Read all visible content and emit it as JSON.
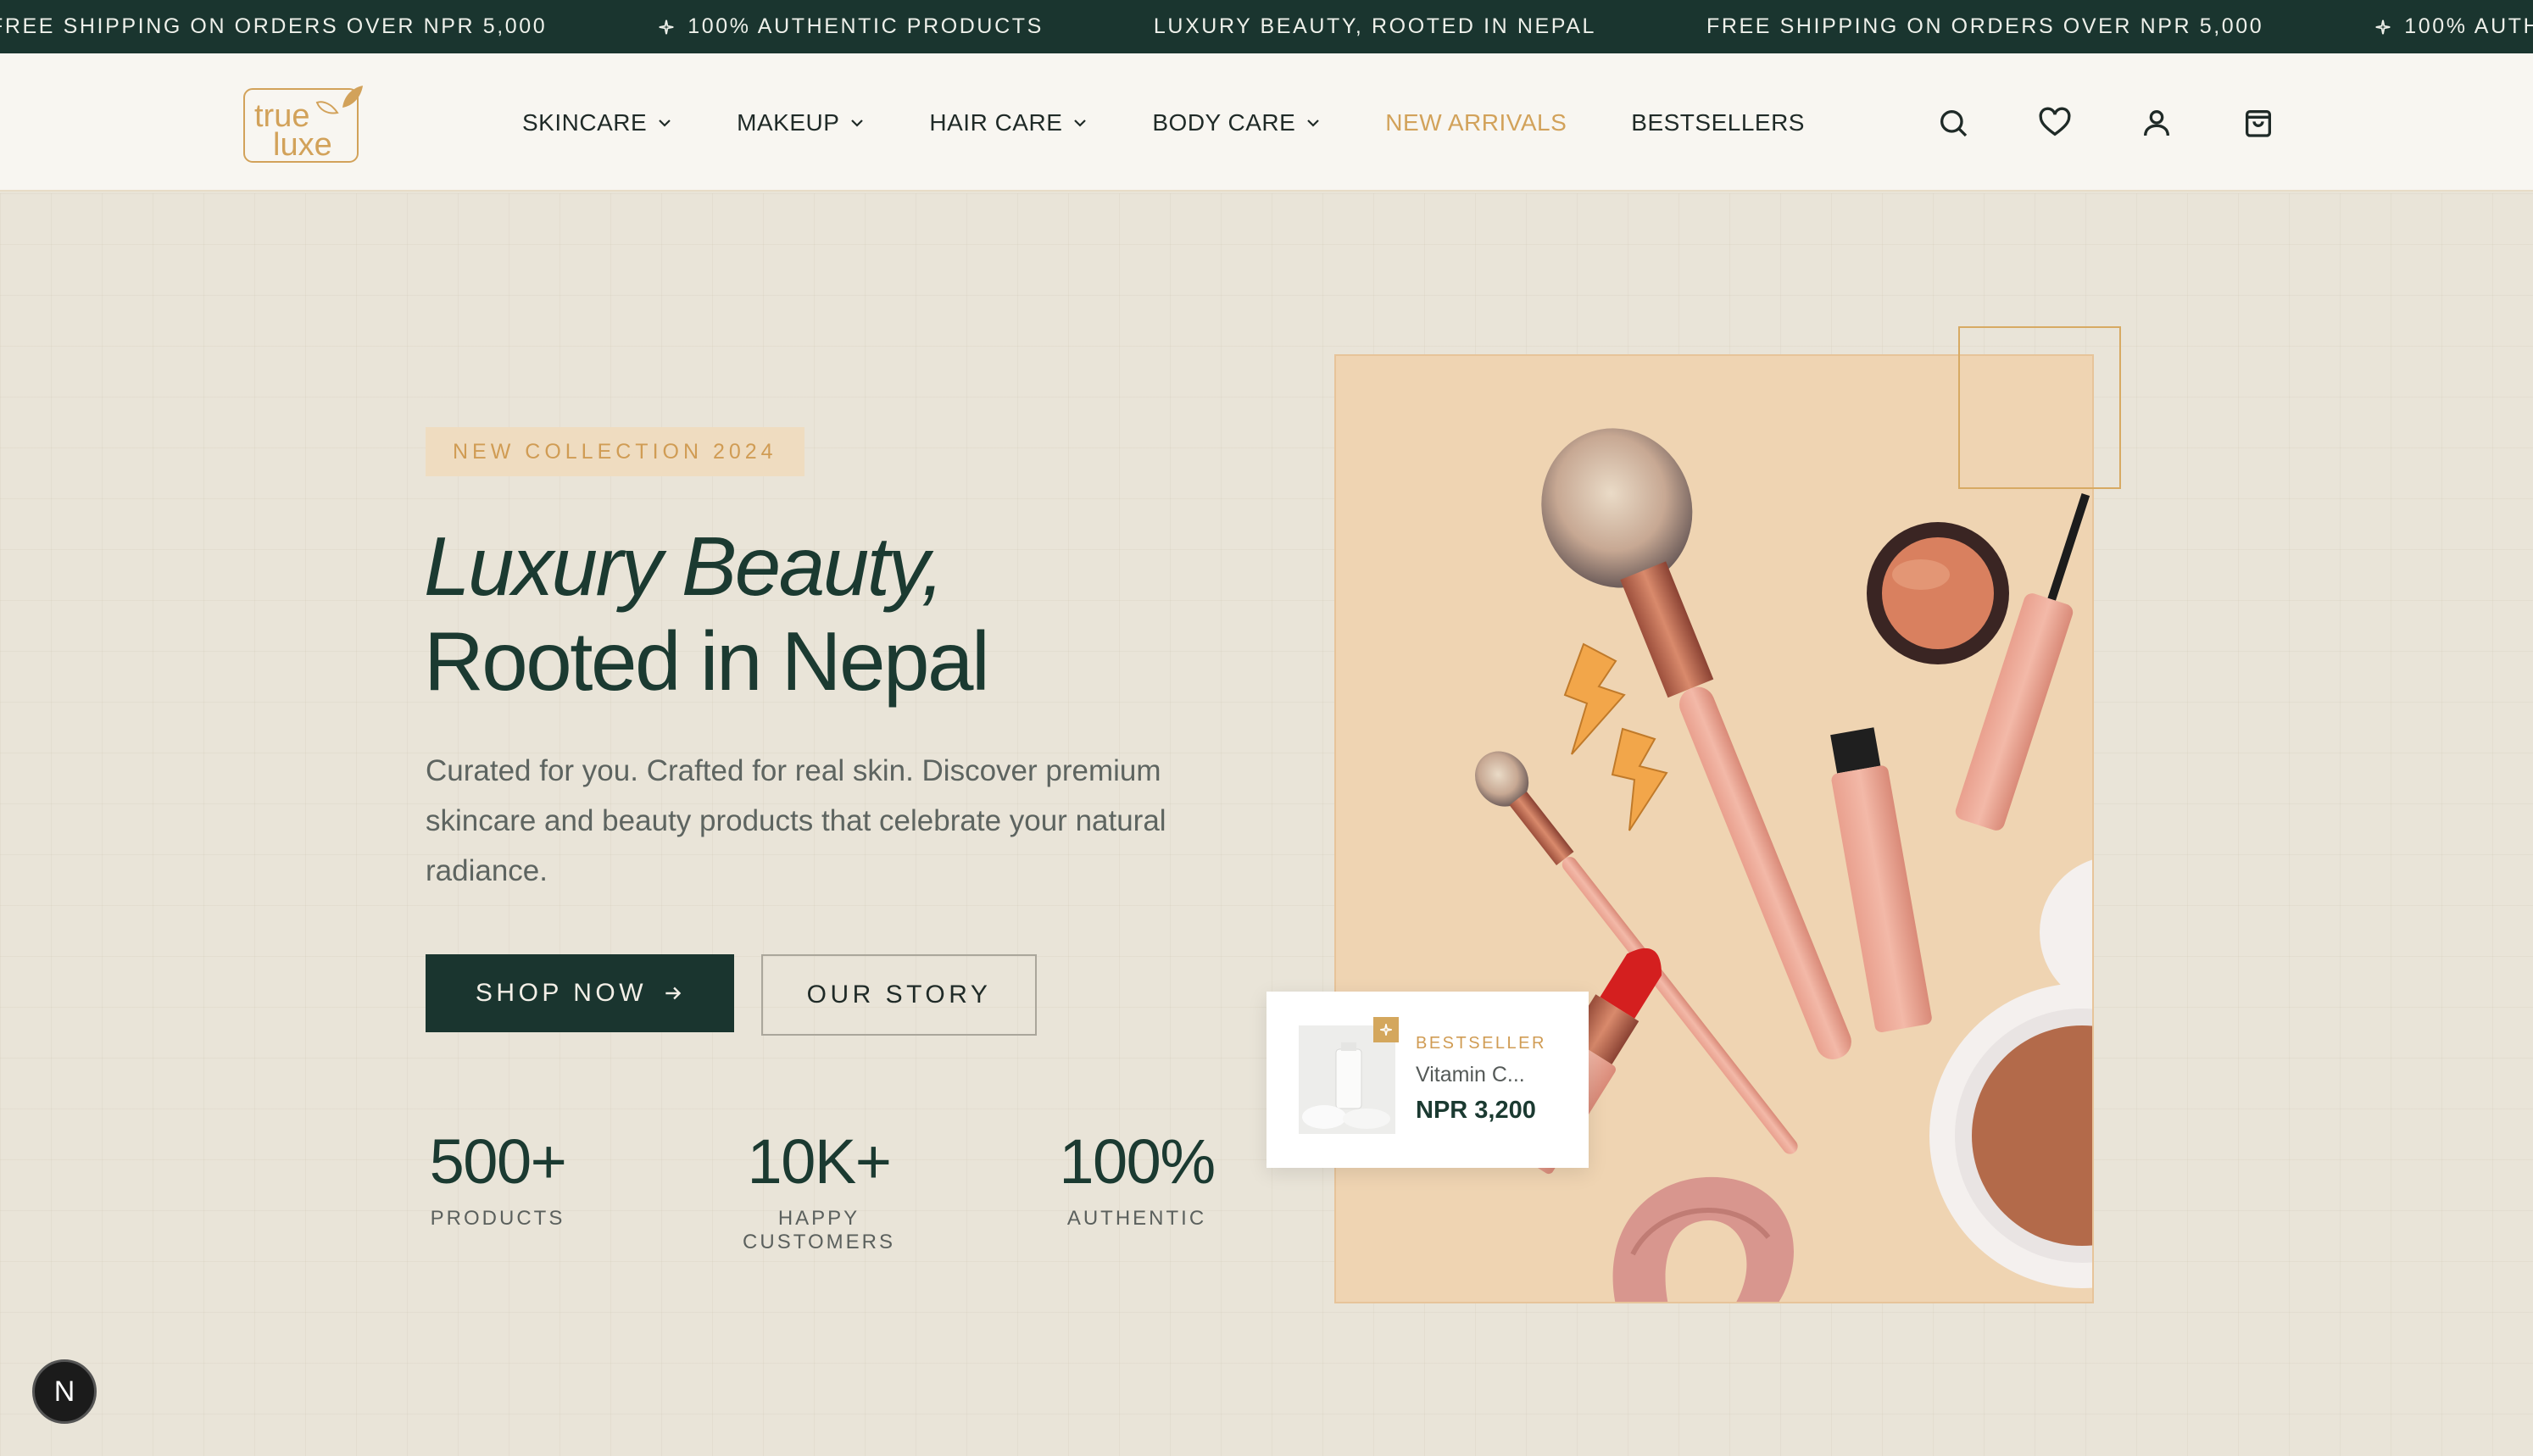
{
  "announcement": {
    "messages": [
      "FREE SHIPPING ON ORDERS OVER NPR 5,000",
      "100% AUTHENTIC PRODUCTS",
      "LUXURY BEAUTY, ROOTED IN NEPAL",
      "FREE SHIPPING ON ORDERS OVER NPR 5,000",
      "100% AUTHENTIC PRODUCTS"
    ]
  },
  "brand": {
    "logo_text_1": "true",
    "logo_text_2": "luxe",
    "accent_color": "#d2a25a",
    "dark_color": "#1a352f"
  },
  "nav": {
    "items": [
      {
        "label": "SKINCARE",
        "has_dropdown": true
      },
      {
        "label": "MAKEUP",
        "has_dropdown": true
      },
      {
        "label": "HAIR CARE",
        "has_dropdown": true
      },
      {
        "label": "BODY CARE",
        "has_dropdown": true
      },
      {
        "label": "NEW ARRIVALS",
        "has_dropdown": false
      },
      {
        "label": "BESTSELLERS",
        "has_dropdown": false
      }
    ]
  },
  "header_icons": [
    "search-icon",
    "heart-icon",
    "user-icon",
    "shopping-bag-icon"
  ],
  "hero": {
    "badge": "NEW COLLECTION 2024",
    "headline_line1": "Luxury Beauty,",
    "headline_line2": "Rooted in Nepal",
    "subtitle": "Curated for you. Crafted for real skin. Discover premium skincare and beauty products that celebrate your natural radiance.",
    "primary_button": "SHOP NOW",
    "secondary_button": "OUR STORY",
    "stats": [
      {
        "value": "500+",
        "label": "PRODUCTS"
      },
      {
        "value": "10K+",
        "label": "HAPPY CUSTOMERS"
      },
      {
        "value": "100%",
        "label": "AUTHENTIC"
      }
    ]
  },
  "featured_product": {
    "tag": "BESTSELLER",
    "name": "Vitamin C...",
    "price": "NPR 3,200"
  },
  "dev_badge": {
    "label": "N"
  }
}
